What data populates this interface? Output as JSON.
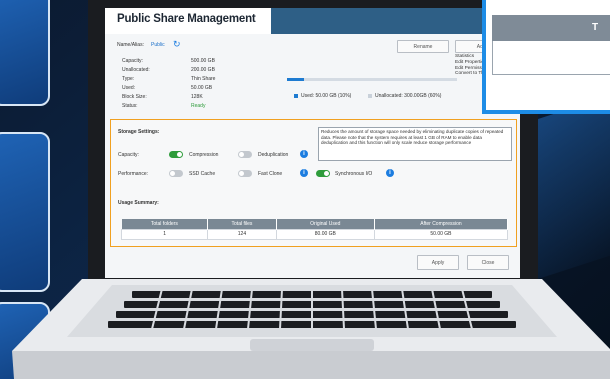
{
  "window": {
    "title": "Public Share Management",
    "name_alias_label": "Name/Alias:",
    "name_alias_value": "Public"
  },
  "info": {
    "rows": [
      {
        "label": "Capacity:",
        "value": "500.00 GB"
      },
      {
        "label": "Unallocated:",
        "value": "200.00 GB"
      },
      {
        "label": "Type:",
        "value": "Thin Share"
      },
      {
        "label": "Used:",
        "value": "50.00 GB"
      },
      {
        "label": "Block Size:",
        "value": "128K"
      },
      {
        "label": "Status:",
        "value": "Ready"
      }
    ],
    "status_color": "#2e9c3b",
    "rename_label": "Rename",
    "actions_label": "Actions",
    "action_items": [
      "Statistics",
      "Edit Properties",
      "Edit Permissions",
      "Convert to Thick Share"
    ]
  },
  "usage": {
    "used_fraction": 0.1,
    "used_legend": "Used: 50.00 GB (10%)",
    "unallocated_legend": "Unallocated: 300.00GB (60%)",
    "used_color": "#1e7bd1"
  },
  "storage": {
    "heading": "Storage Settings:",
    "info_text": "Reduces the amount of storage space needed by eliminating duplicate copies of repeated data. Please note that the system requires at least 1 GB of RAM to enable data deduplication and this function will only scale reduce storage performance",
    "capacity_label": "Capacity:",
    "compression_label": "Compression",
    "compression_on": true,
    "dedup_label": "Deduplication",
    "dedup_on": false,
    "performance_label": "Performance:",
    "ssd_cache_label": "SSD Cache",
    "ssd_cache_on": false,
    "fast_clone_label": "Fast Clone",
    "fast_clone_on": false,
    "sync_io_label": "Synchronous I/O",
    "sync_io_on": true
  },
  "usage_summary": {
    "heading": "Usage Summary:",
    "columns": [
      "Total folders",
      "Total files",
      "Original Used",
      "After Compression"
    ],
    "rows": [
      [
        "1",
        "124",
        "80.00 GB",
        "50.00 GB"
      ]
    ]
  },
  "footer": {
    "apply_label": "Apply",
    "close_label": "Close"
  },
  "overlay": {
    "head_text": "T"
  }
}
